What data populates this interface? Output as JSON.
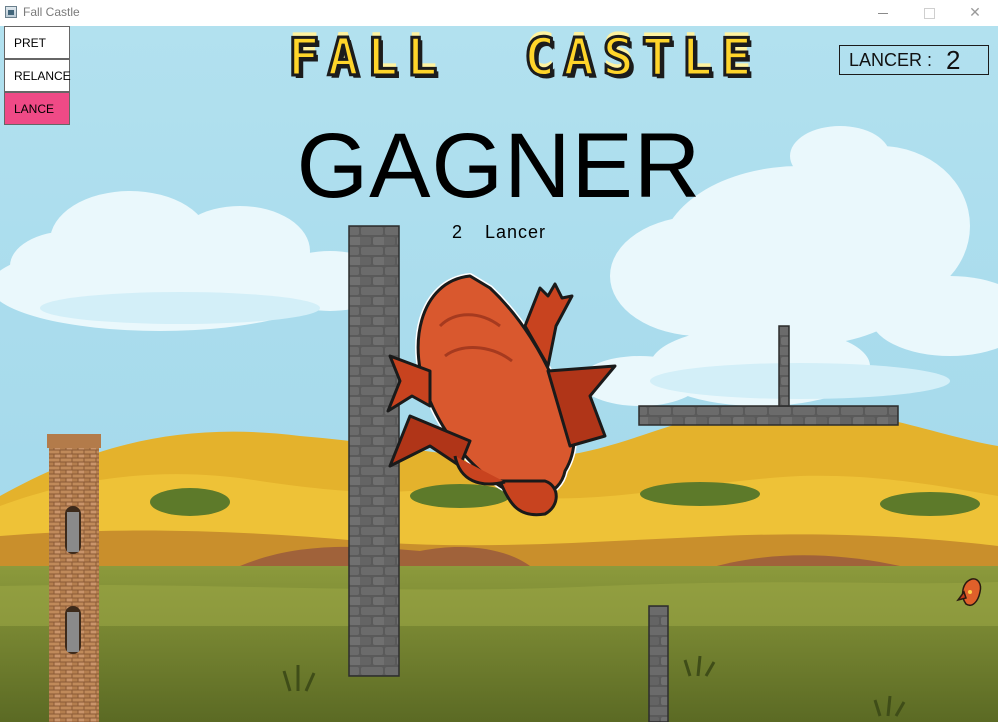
{
  "window": {
    "title": "Fall Castle",
    "min_glyph": "",
    "max_glyph": "",
    "close_glyph": "✕"
  },
  "menu": {
    "pret": "PRET",
    "relance": "RELANCE",
    "lance": "LANCE"
  },
  "game": {
    "logo": "FALL  CASTLE",
    "counter_label": "LANCER :",
    "counter_value": "2",
    "result": "GAGNER",
    "throws_count": "2",
    "throws_label": "Lancer"
  },
  "colors": {
    "sky": "#a9dced",
    "active_button": "#ef4a86",
    "logo_yellow": "#ffd52a",
    "dragon": "#d9542b"
  }
}
